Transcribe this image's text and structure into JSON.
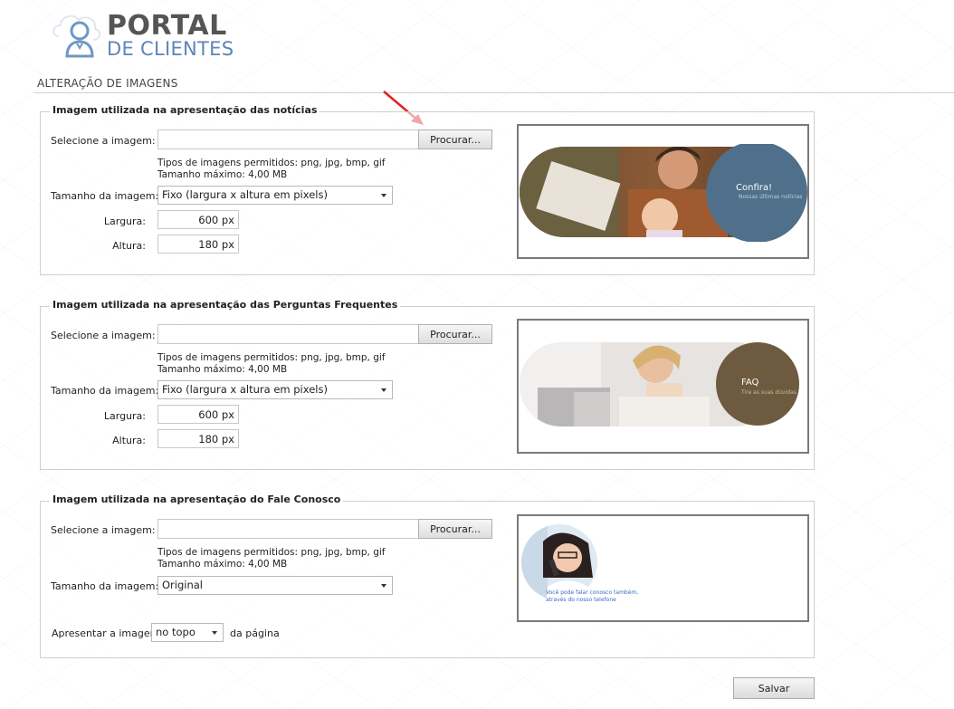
{
  "logo": {
    "title": "PORTAL",
    "subtitle": "DE CLIENTES"
  },
  "page_title": "ALTERAÇÃO DE IMAGENS",
  "common": {
    "select_image_label": "Selecione a imagem:",
    "browse_label": "Procurar...",
    "hint_types": "Tipos de imagens permitidos: png, jpg, bmp, gif",
    "hint_size": "Tamanho máximo: 4,00 MB",
    "size_label": "Tamanho da imagem:",
    "width_label": "Largura:",
    "height_label": "Altura:"
  },
  "sections": [
    {
      "legend": "Imagem utilizada na apresentação das notícias",
      "size_mode": "Fixo (largura x altura em pixels)",
      "width": "600 px",
      "height": "180 px",
      "preview": {
        "heading": "Confira!",
        "subtext": "Nossas últimas notícias",
        "color": "#4f6f8a"
      }
    },
    {
      "legend": "Imagem utilizada na apresentação das Perguntas Frequentes",
      "size_mode": "Fixo (largura x altura em pixels)",
      "width": "600 px",
      "height": "180 px",
      "preview": {
        "heading": "FAQ",
        "subtext": "Tire as suas dúvidas",
        "color": "#6e5a3e"
      }
    },
    {
      "legend": "Imagem utilizada na apresentação do Fale Conosco",
      "size_mode": "Original",
      "position_label": "Apresentar a imagem",
      "position_value": "no topo",
      "position_suffix": "da página",
      "preview": {
        "line1": "Você pode falar conosco também,",
        "line2": "através do nosso telefone",
        "color": "#3a6bc4"
      }
    }
  ],
  "save_label": "Salvar",
  "colors": {
    "accent_red": "#e02020",
    "logo_blue": "#5b86b8",
    "logo_gray": "#555555"
  }
}
